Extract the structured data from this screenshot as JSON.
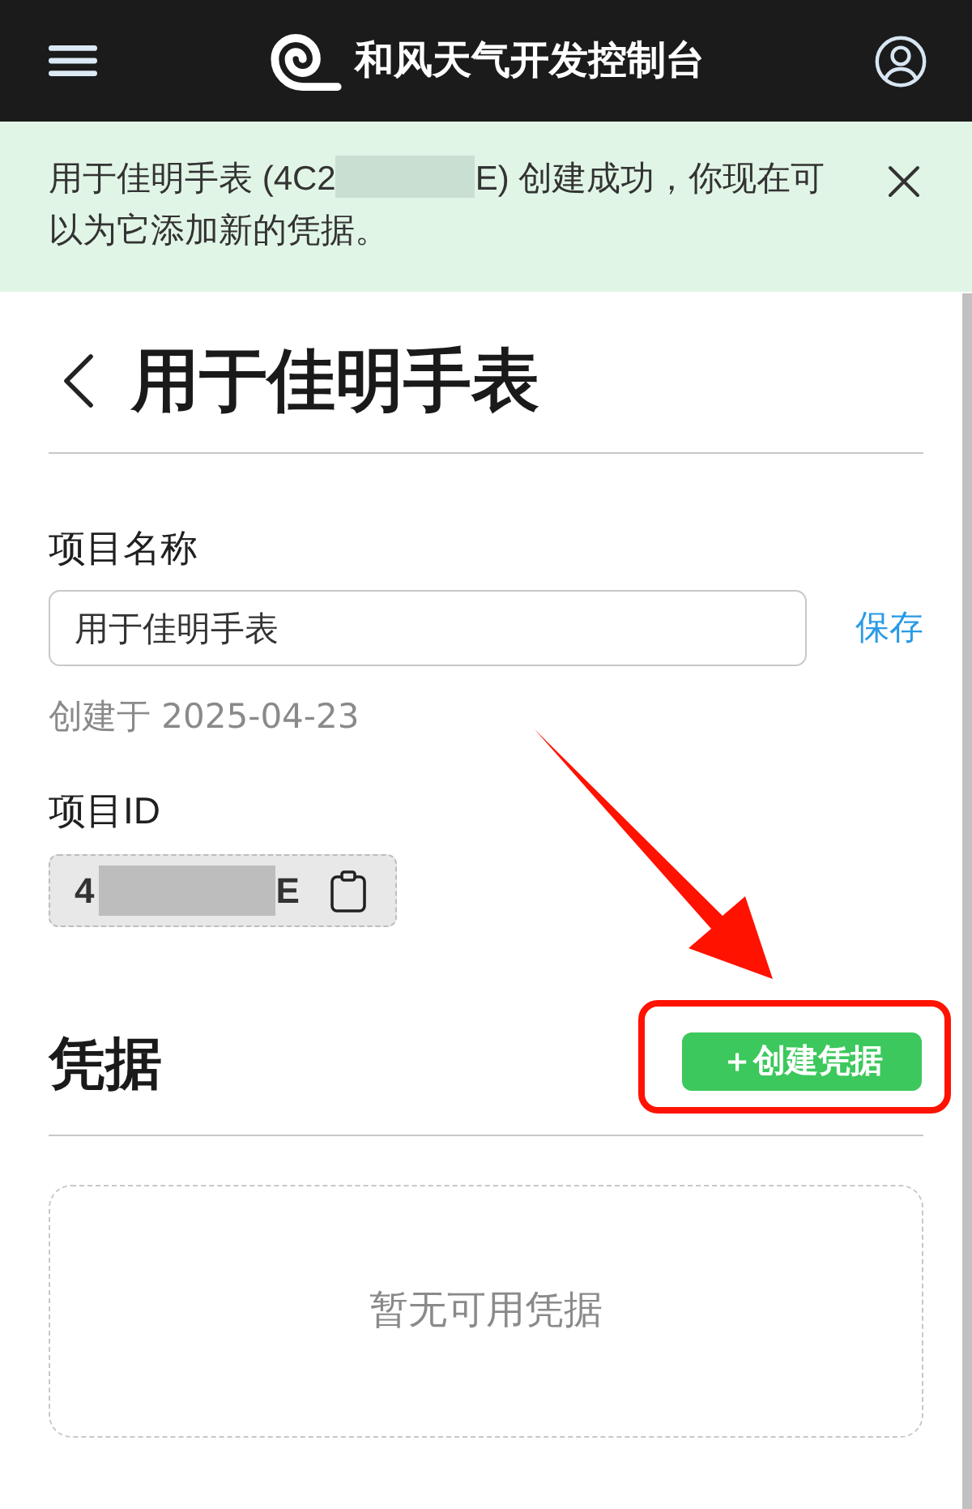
{
  "header": {
    "title": "和风天气开发控制台"
  },
  "notice": {
    "message_before": "用于佳明手表 (4C2",
    "message_after": "E) 创建成功，你现在可以为它添加新的凭据。"
  },
  "page": {
    "title": "用于佳明手表"
  },
  "project_name": {
    "label": "项目名称",
    "value": "用于佳明手表",
    "save": "保存",
    "created": "创建于 2025-04-23"
  },
  "project_id": {
    "label": "项目ID",
    "value_before": "4",
    "value_after": "E"
  },
  "credentials": {
    "title": "凭据",
    "create_button": {
      "label": "＋创建凭据",
      "highlighted": true
    },
    "empty_text": "暂无可用凭据"
  }
}
